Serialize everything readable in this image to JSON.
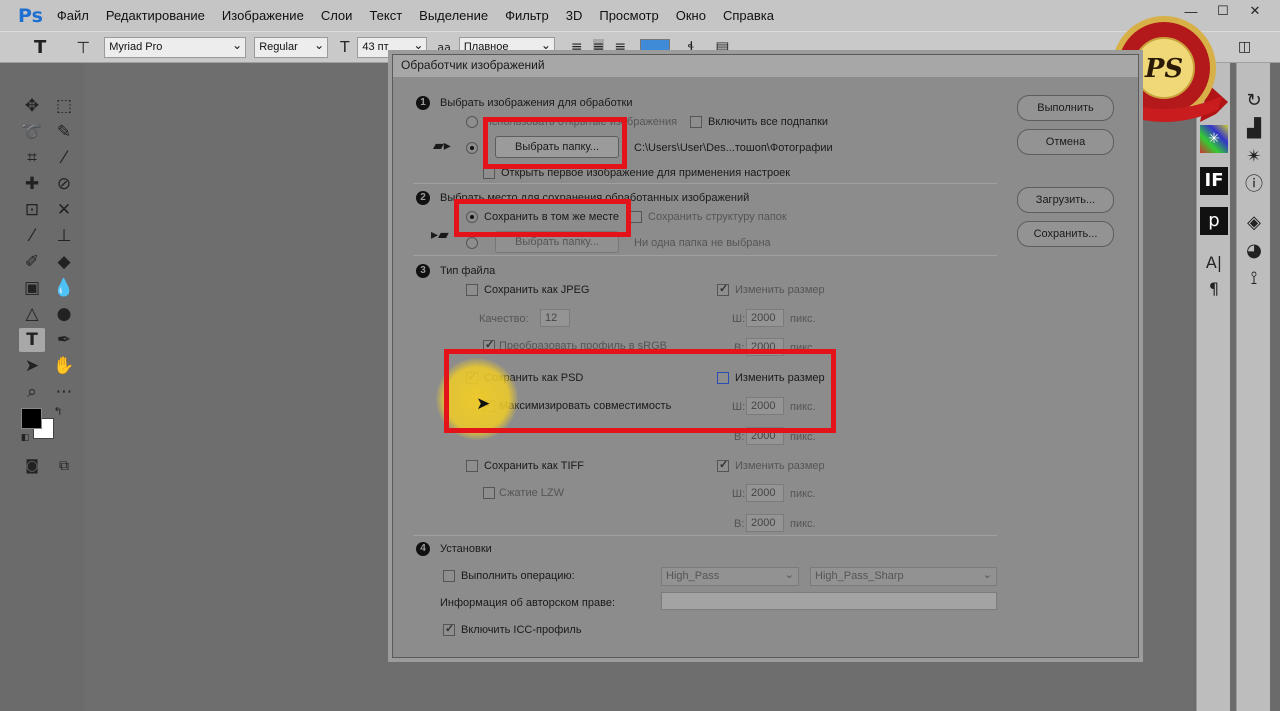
{
  "app": {
    "logo": "Ps"
  },
  "menu": [
    "Файл",
    "Редактирование",
    "Изображение",
    "Слои",
    "Текст",
    "Выделение",
    "Фильтр",
    "3D",
    "Просмотр",
    "Окно",
    "Справка"
  ],
  "window_controls": {
    "minimize": "—",
    "maximize": "☐",
    "close": "✕"
  },
  "options": {
    "tool_icon": "T",
    "font_family": "Myriad Pro",
    "font_style": "Regular",
    "font_size": "43 пт",
    "aa_label": "aa",
    "aa_mode": "Плавное",
    "color": "#3f8bd8"
  },
  "watermark": {
    "text": "PS"
  },
  "dialog": {
    "title": "Обработчик изображений",
    "section1": {
      "num": "1",
      "heading": "Выбрать изображения для обработки",
      "use_open": "Использовать открытые изображения",
      "include_subfolders": "Включить все подпапки",
      "choose_folder": "Выбрать папку...",
      "folder_path": "C:\\Users\\User\\Des...тошоп\\Фотографии",
      "open_first": "Открыть первое изображение для применения настроек"
    },
    "section2": {
      "num": "2",
      "heading": "Выбрать место для сохранения обработанных изображений",
      "save_same": "Сохранить в том же месте",
      "keep_structure": "Сохранить структуру папок",
      "choose_folder": "Выбрать папку...",
      "no_folder": "Ни одна папка не выбрана"
    },
    "section3": {
      "num": "3",
      "heading": "Тип файла",
      "jpeg": {
        "label": "Сохранить как JPEG",
        "resize": "Изменить размер",
        "quality_label": "Качество:",
        "quality": "12",
        "w_label": "Ш:",
        "w": "2000",
        "h_label": "В:",
        "h": "2000",
        "unit": "пикс.",
        "srgb": "Преобразовать профиль в sRGB"
      },
      "psd": {
        "label": "Сохранить как PSD",
        "resize": "Изменить размер",
        "maximize": "Максимизировать совместимость",
        "w_label": "Ш:",
        "w": "2000",
        "h_label": "В:",
        "h": "2000",
        "unit": "пикс."
      },
      "tiff": {
        "label": "Сохранить как TIFF",
        "resize": "Изменить размер",
        "lzw": "Сжатие LZW",
        "w_label": "Ш:",
        "w": "2000",
        "h_label": "В:",
        "h": "2000",
        "unit": "пикс."
      }
    },
    "section4": {
      "num": "4",
      "heading": "Установки",
      "run_action": "Выполнить операцию:",
      "action_set": "High_Pass",
      "action": "High_Pass_Sharp",
      "copyright_label": "Информация об авторском праве:",
      "copyright_value": "",
      "icc": "Включить ICC-профиль"
    },
    "buttons": {
      "run": "Выполнить",
      "cancel": "Отмена",
      "load": "Загрузить...",
      "save": "Сохранить..."
    }
  }
}
